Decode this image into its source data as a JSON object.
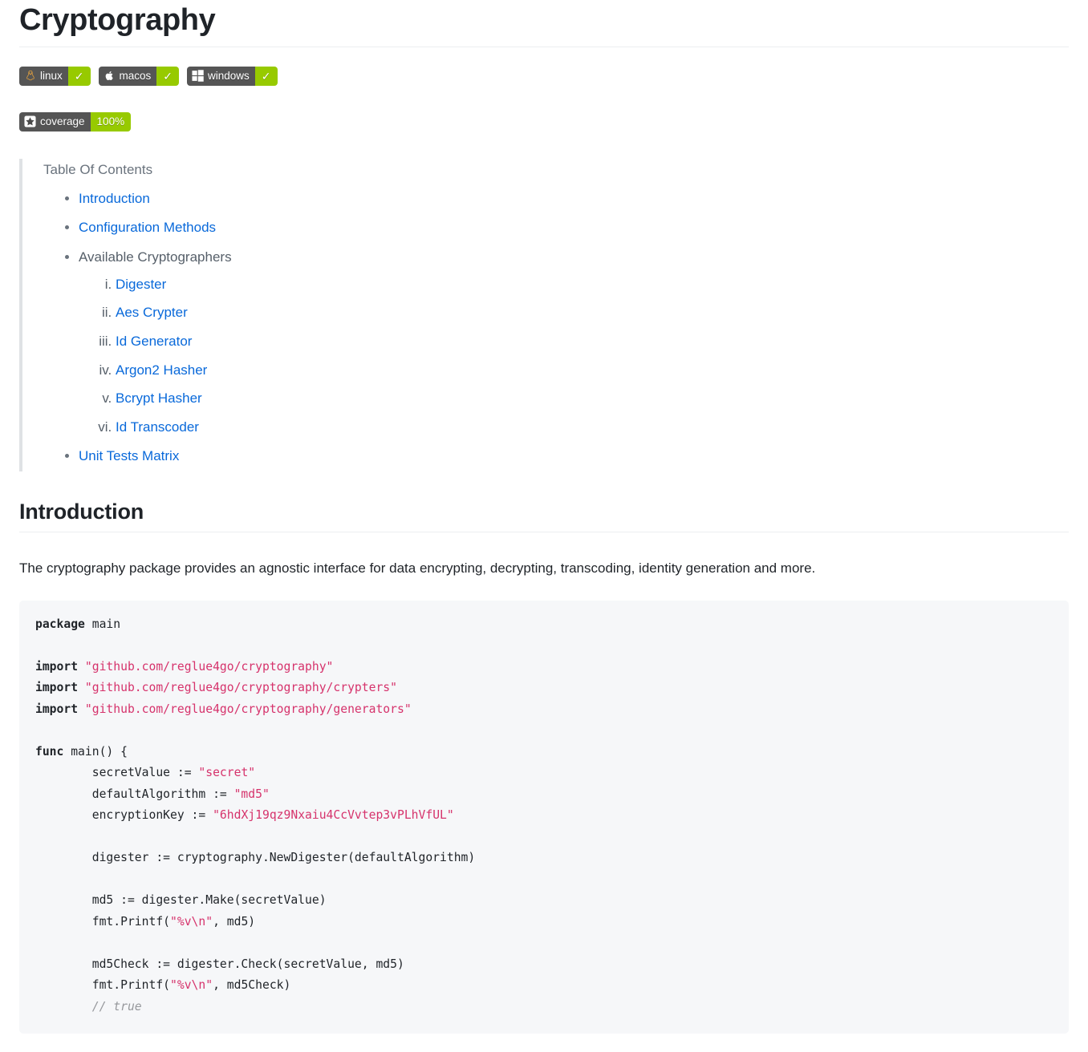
{
  "page": {
    "title": "Cryptography"
  },
  "badges": {
    "platform": [
      {
        "icon": "linux-tux-icon",
        "label": "linux",
        "status": "✓",
        "left_color": "#555555",
        "right_color": "#97ca00"
      },
      {
        "icon": "apple-icon",
        "label": "macos",
        "status": "✓",
        "left_color": "#555555",
        "right_color": "#97ca00"
      },
      {
        "icon": "windows-icon",
        "label": "windows",
        "status": "✓",
        "left_color": "#555555",
        "right_color": "#97ca00"
      }
    ],
    "coverage": {
      "icon": "star-icon",
      "label": "coverage",
      "value": "100%",
      "left_color": "#555555",
      "right_color": "#97ca00"
    }
  },
  "toc": {
    "heading": "Table Of Contents",
    "items": [
      {
        "label": "Introduction",
        "is_link": true
      },
      {
        "label": "Configuration Methods",
        "is_link": true
      },
      {
        "label": "Available Cryptographers",
        "is_link": false,
        "children": [
          {
            "label": "Digester",
            "is_link": true
          },
          {
            "label": "Aes Crypter",
            "is_link": true
          },
          {
            "label": "Id Generator",
            "is_link": true
          },
          {
            "label": "Argon2 Hasher",
            "is_link": true
          },
          {
            "label": "Bcrypt Hasher",
            "is_link": true
          },
          {
            "label": "Id Transcoder",
            "is_link": true
          }
        ]
      },
      {
        "label": "Unit Tests Matrix",
        "is_link": true
      }
    ]
  },
  "introduction": {
    "heading": "Introduction",
    "paragraph": "The cryptography package provides an agnostic interface for data encrypting, decrypting, transcoding, identity generation and more.",
    "code": {
      "language": "go",
      "lines": [
        [
          {
            "t": "package",
            "c": "kw"
          },
          {
            "t": " main",
            "c": ""
          }
        ],
        [],
        [
          {
            "t": "import",
            "c": "kw"
          },
          {
            "t": " ",
            "c": ""
          },
          {
            "t": "\"github.com/reglue4go/cryptography\"",
            "c": "str"
          }
        ],
        [
          {
            "t": "import",
            "c": "kw"
          },
          {
            "t": " ",
            "c": ""
          },
          {
            "t": "\"github.com/reglue4go/cryptography/crypters\"",
            "c": "str"
          }
        ],
        [
          {
            "t": "import",
            "c": "kw"
          },
          {
            "t": " ",
            "c": ""
          },
          {
            "t": "\"github.com/reglue4go/cryptography/generators\"",
            "c": "str"
          }
        ],
        [],
        [
          {
            "t": "func",
            "c": "kw"
          },
          {
            "t": " main() {",
            "c": ""
          }
        ],
        [
          {
            "t": "        secretValue := ",
            "c": ""
          },
          {
            "t": "\"secret\"",
            "c": "str"
          }
        ],
        [
          {
            "t": "        defaultAlgorithm := ",
            "c": ""
          },
          {
            "t": "\"md5\"",
            "c": "str"
          }
        ],
        [
          {
            "t": "        encryptionKey := ",
            "c": ""
          },
          {
            "t": "\"6hdXj19qz9Nxaiu4CcVvtep3vPLhVfUL\"",
            "c": "str"
          }
        ],
        [],
        [
          {
            "t": "        digester := cryptography.NewDigester(defaultAlgorithm)",
            "c": ""
          }
        ],
        [],
        [
          {
            "t": "        md5 := digester.Make(secretValue)",
            "c": ""
          }
        ],
        [
          {
            "t": "        fmt.Printf(",
            "c": ""
          },
          {
            "t": "\"%v\\n\"",
            "c": "str"
          },
          {
            "t": ", md5)",
            "c": ""
          }
        ],
        [],
        [
          {
            "t": "        md5Check := digester.Check(secretValue, md5)",
            "c": ""
          }
        ],
        [
          {
            "t": "        fmt.Printf(",
            "c": ""
          },
          {
            "t": "\"%v\\n\"",
            "c": "str"
          },
          {
            "t": ", md5Check)",
            "c": ""
          }
        ],
        [
          {
            "t": "        // true",
            "c": "cmt"
          }
        ]
      ]
    }
  }
}
